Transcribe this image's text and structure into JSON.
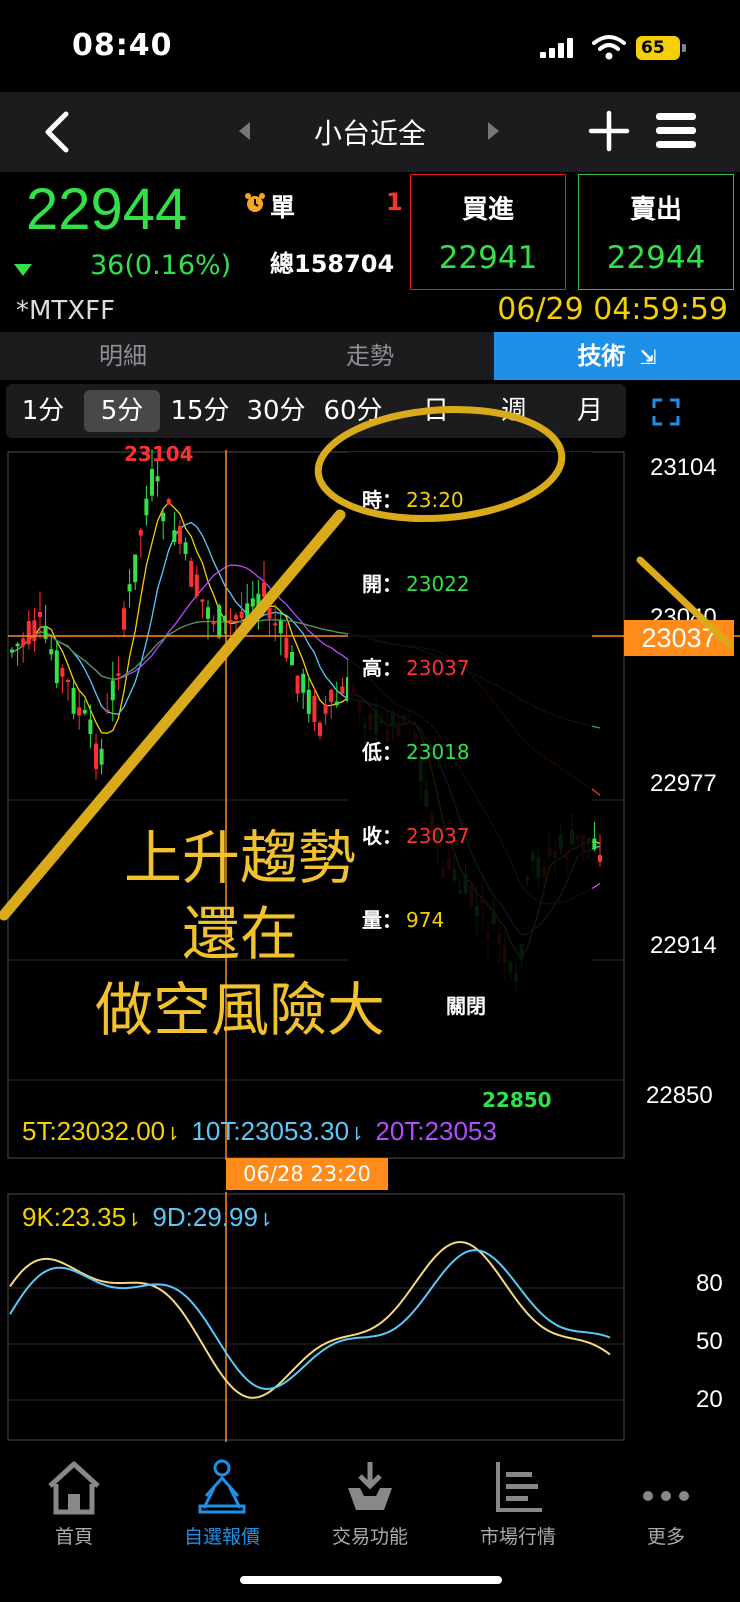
{
  "status_bar": {
    "time": "08:40",
    "battery": "65"
  },
  "nav": {
    "title": "小台近全"
  },
  "quote": {
    "price": "22944",
    "change": "36(0.16%)",
    "single_label": "單",
    "single_value": "1",
    "total_label": "總158704",
    "buy_label": "買進",
    "buy_price": "22941",
    "sell_label": "賣出",
    "sell_price": "22944",
    "symbol": "*MTXFF",
    "datetime": "06/29 04:59:59"
  },
  "tabs": [
    "明細",
    "走勢",
    "技術"
  ],
  "periods": [
    "1分",
    "5分",
    "15分",
    "30分",
    "60分",
    "日",
    "週",
    "月"
  ],
  "main_chart": {
    "high_label": "23104",
    "low_label": "22850",
    "axis_labels": [
      "23104",
      "23040",
      "22977",
      "22914",
      "22850"
    ],
    "crosshair_value": "23037",
    "ma_5t": "5T:23032.00",
    "ma_10t": "10T:23053.30",
    "ma_20t": "20T:23053",
    "crosshair_time": "06/28 23:20"
  },
  "popup": {
    "time_label": "時：",
    "time_value": "23:20",
    "open_label": "開：",
    "open_value": "23022",
    "high_label": "高：",
    "high_value": "23037",
    "low_label": "低：",
    "low_value": "23018",
    "close_label": "收：",
    "close_value": "23037",
    "vol_label": "量：",
    "vol_value": "974",
    "close_button": "關閉"
  },
  "kd_chart": {
    "k_label": "9K:23.35",
    "d_label": "9D:29.99",
    "axis_labels": [
      "80",
      "50",
      "20"
    ]
  },
  "annotation": [
    "上升趨勢",
    "還在",
    "做空風險大"
  ],
  "bottom_nav": [
    {
      "label": "首頁",
      "icon": "home-icon"
    },
    {
      "label": "自選報價",
      "icon": "watchlist-icon"
    },
    {
      "label": "交易功能",
      "icon": "trade-icon"
    },
    {
      "label": "市場行情",
      "icon": "market-icon"
    },
    {
      "label": "更多",
      "icon": "more-icon"
    }
  ],
  "colors": {
    "up": "#ff3030",
    "down": "#32e04a",
    "accent": "#1e90e8",
    "highlight": "#f5d000",
    "crosshair": "#ff8c1a",
    "annotation": "#f2c12e"
  }
}
